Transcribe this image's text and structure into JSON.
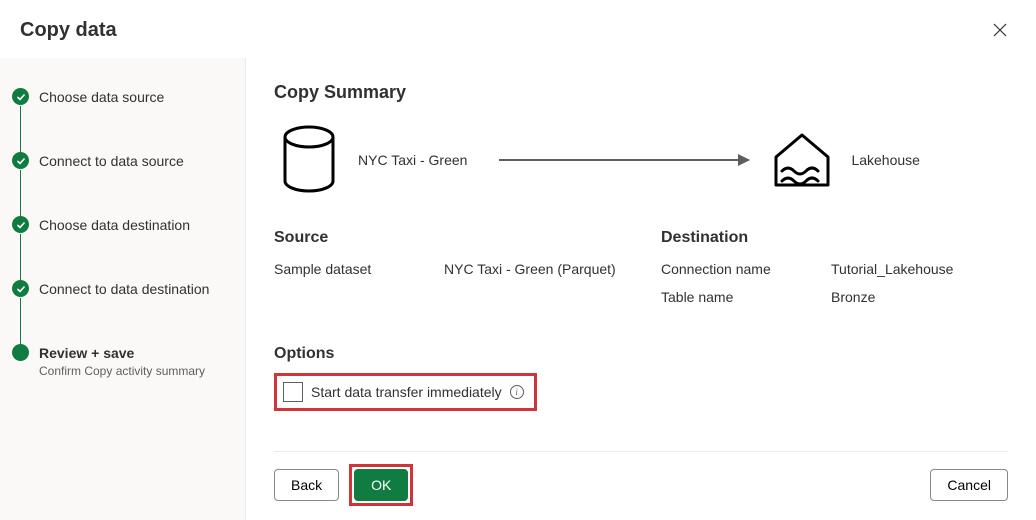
{
  "dialog": {
    "title": "Copy data"
  },
  "steps": [
    {
      "label": "Choose data source",
      "done": true
    },
    {
      "label": "Connect to data source",
      "done": true
    },
    {
      "label": "Choose data destination",
      "done": true
    },
    {
      "label": "Connect to data destination",
      "done": true
    },
    {
      "label": "Review + save",
      "sub": "Confirm Copy activity summary",
      "current": true
    }
  ],
  "summary": {
    "title": "Copy Summary",
    "source_label": "NYC Taxi - Green",
    "dest_label": "Lakehouse"
  },
  "source": {
    "heading": "Source",
    "fields": {
      "sample_dataset_label": "Sample dataset",
      "sample_dataset_value": "NYC Taxi - Green (Parquet)"
    }
  },
  "destination": {
    "heading": "Destination",
    "fields": {
      "connection_label": "Connection name",
      "connection_value": "Tutorial_Lakehouse",
      "table_label": "Table name",
      "table_value": "Bronze"
    }
  },
  "options": {
    "heading": "Options",
    "start_transfer_label": "Start data transfer immediately"
  },
  "buttons": {
    "back": "Back",
    "ok": "OK",
    "cancel": "Cancel"
  }
}
